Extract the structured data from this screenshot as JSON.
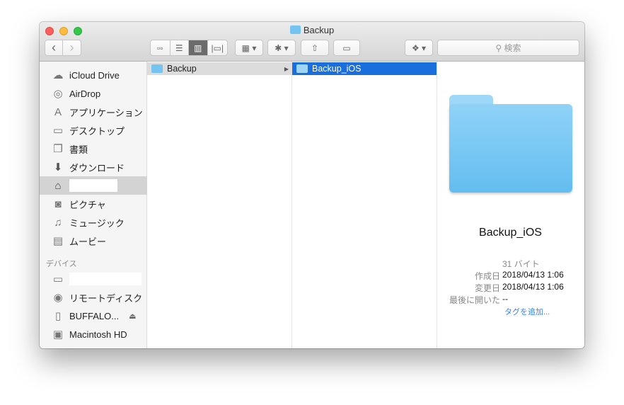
{
  "window": {
    "title": "Backup"
  },
  "toolbar": {
    "back": "‹",
    "forward": "›",
    "search_placeholder": "検索"
  },
  "sidebar": {
    "items": [
      {
        "label": "iCloud Drive",
        "icon": "cloud-icon"
      },
      {
        "label": "AirDrop",
        "icon": "airdrop-icon"
      },
      {
        "label": "アプリケーション",
        "icon": "applications-icon"
      },
      {
        "label": "デスクトップ",
        "icon": "desktop-icon"
      },
      {
        "label": "書類",
        "icon": "documents-icon"
      },
      {
        "label": "ダウンロード",
        "icon": "downloads-icon"
      },
      {
        "label": "",
        "icon": "home-icon"
      },
      {
        "label": "ピクチャ",
        "icon": "camera-icon"
      },
      {
        "label": "ミュージック",
        "icon": "music-icon"
      },
      {
        "label": "ムービー",
        "icon": "film-icon"
      }
    ],
    "devices_header": "デバイス",
    "devices": [
      {
        "label": "",
        "icon": "computer-icon"
      },
      {
        "label": "リモートディスク",
        "icon": "disc-icon"
      },
      {
        "label": "BUFFALO...",
        "icon": "drive-icon"
      },
      {
        "label": "Macintosh HD",
        "icon": "hard-disk-icon"
      }
    ]
  },
  "columns": [
    {
      "items": [
        {
          "name": "Backup"
        }
      ]
    },
    {
      "items": [
        {
          "name": "Backup_iOS"
        }
      ]
    }
  ],
  "preview": {
    "name": "Backup_iOS",
    "size": "31 バイト",
    "created_label": "作成日",
    "created": "2018/04/13 1:06",
    "modified_label": "変更日",
    "modified": "2018/04/13 1:06",
    "opened_label": "最後に開いた",
    "opened": "--",
    "add_tags": "タグを追加..."
  },
  "colors": {
    "selection": "#1a6fdc",
    "folder": "#74c3f0"
  }
}
